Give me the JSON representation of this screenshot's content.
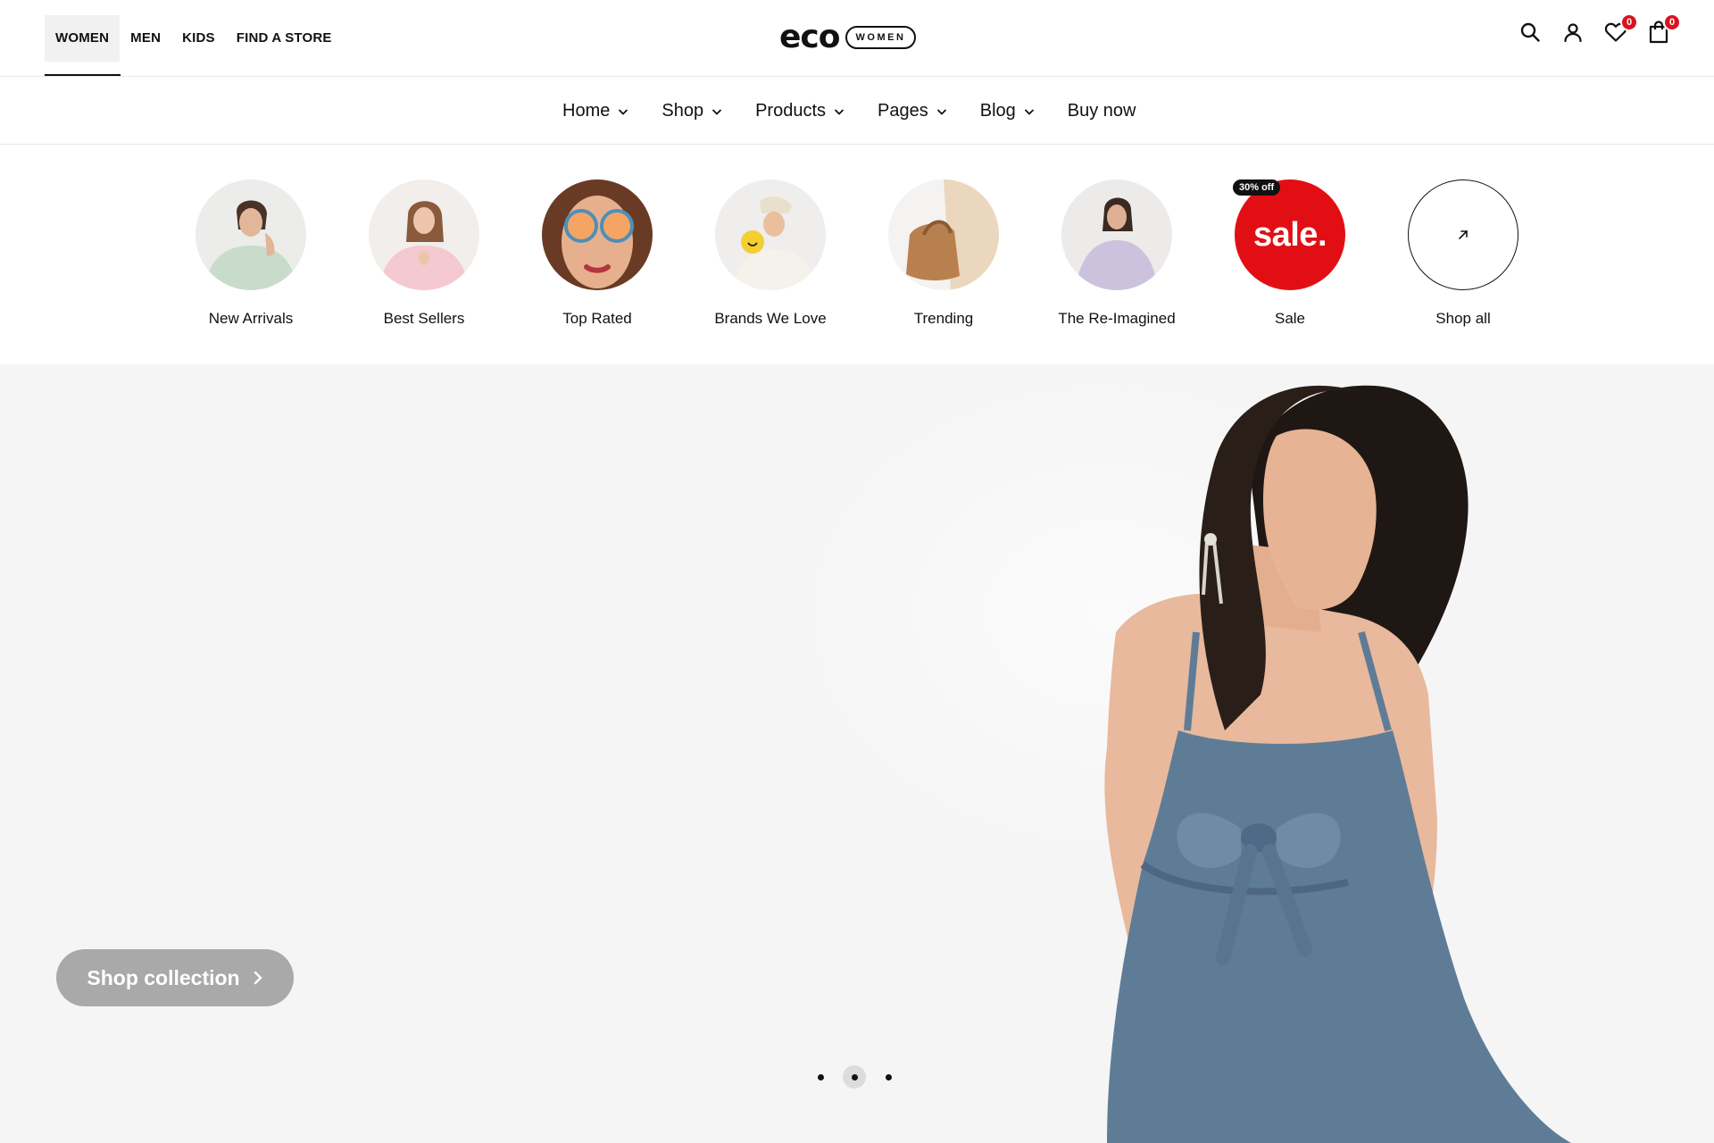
{
  "gender_nav": [
    {
      "label": "WOMEN",
      "active": true
    },
    {
      "label": "MEN",
      "active": false
    },
    {
      "label": "KIDS",
      "active": false
    },
    {
      "label": "FIND A STORE",
      "active": false
    }
  ],
  "logo": {
    "word": "eco",
    "tag": "WOMEN"
  },
  "header_icons": {
    "search": "search-icon",
    "account": "user-icon",
    "wishlist": {
      "icon": "heart-icon",
      "count": "0"
    },
    "cart": {
      "icon": "bag-icon",
      "count": "0"
    }
  },
  "main_nav": [
    {
      "label": "Home",
      "dropdown": true
    },
    {
      "label": "Shop",
      "dropdown": true
    },
    {
      "label": "Products",
      "dropdown": true
    },
    {
      "label": "Pages",
      "dropdown": true
    },
    {
      "label": "Blog",
      "dropdown": true
    },
    {
      "label": "Buy now",
      "dropdown": false
    }
  ],
  "categories": [
    {
      "label": "New Arrivals"
    },
    {
      "label": "Best Sellers"
    },
    {
      "label": "Top Rated"
    },
    {
      "label": "Brands We Love"
    },
    {
      "label": "Trending"
    },
    {
      "label": "The Re-Imagined"
    },
    {
      "label": "Sale",
      "circle_text": "sale.",
      "tag": "30% off"
    },
    {
      "label": "Shop all",
      "icon": "arrow-up-right-icon"
    }
  ],
  "hero": {
    "cta_label": "Shop collection",
    "slides": 3,
    "active_slide": 2
  },
  "colors": {
    "accent_red": "#e10f14",
    "badge_red": "#d9121f",
    "dress_blue": "#5f7c97",
    "hero_bg": "#f5f5f5"
  }
}
